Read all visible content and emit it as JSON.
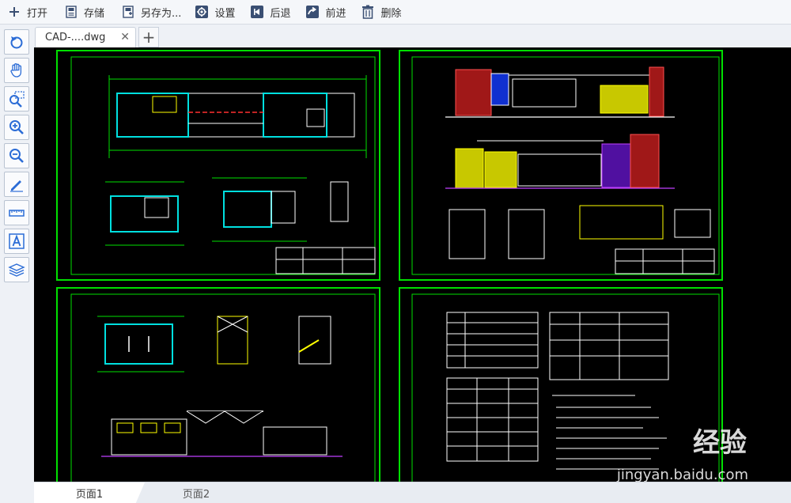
{
  "toolbar": {
    "open_label": "打开",
    "save_label": "存储",
    "save_as_label": "另存为...",
    "settings_label": "设置",
    "back_label": "后退",
    "forward_label": "前进",
    "delete_label": "删除"
  },
  "tabs": {
    "document_name": "CAD-....dwg",
    "close_glyph": "✕",
    "add_glyph": "+"
  },
  "left_tools": [
    {
      "name": "rotate-view"
    },
    {
      "name": "pan-hand"
    },
    {
      "name": "zoom-window"
    },
    {
      "name": "zoom-in"
    },
    {
      "name": "zoom-out"
    },
    {
      "name": "draw-pen"
    },
    {
      "name": "measure-ruler"
    },
    {
      "name": "text-tool",
      "glyph": "A"
    },
    {
      "name": "layers"
    }
  ],
  "pages": {
    "page1_label": "页面1",
    "page2_label": "页面2"
  },
  "watermark": {
    "brand": "经验",
    "url": "jingyan.baidu.com"
  },
  "colors": {
    "accent": "#2b6cd6",
    "canvas_bg": "#000000",
    "frame_green": "#00e000"
  }
}
